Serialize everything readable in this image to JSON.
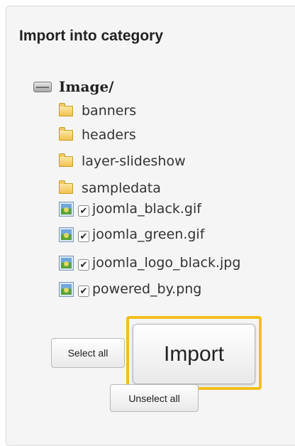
{
  "panel": {
    "title": "Import into category"
  },
  "tree": {
    "root": {
      "label": "Image/",
      "icon": "drive-icon"
    },
    "folders": [
      {
        "label": "banners",
        "icon": "folder-icon"
      },
      {
        "label": "headers",
        "icon": "folder-icon"
      },
      {
        "label": "layer-slideshow",
        "icon": "folder-icon"
      },
      {
        "label": "sampledata",
        "icon": "folder-icon"
      }
    ],
    "files": [
      {
        "label": "joomla_black.gif",
        "icon": "image-icon",
        "checked": true
      },
      {
        "label": "joomla_green.gif",
        "icon": "image-icon",
        "checked": true
      },
      {
        "label": "joomla_logo_black.jpg",
        "icon": "image-icon",
        "checked": true
      },
      {
        "label": "powered_by.png",
        "icon": "image-icon",
        "checked": true
      }
    ]
  },
  "buttons": {
    "select_all": "Select all",
    "import": "Import",
    "unselect_all": "Unselect all"
  },
  "colors": {
    "highlight": "#f2bf1e",
    "panel_background": "#f5f5f5"
  }
}
